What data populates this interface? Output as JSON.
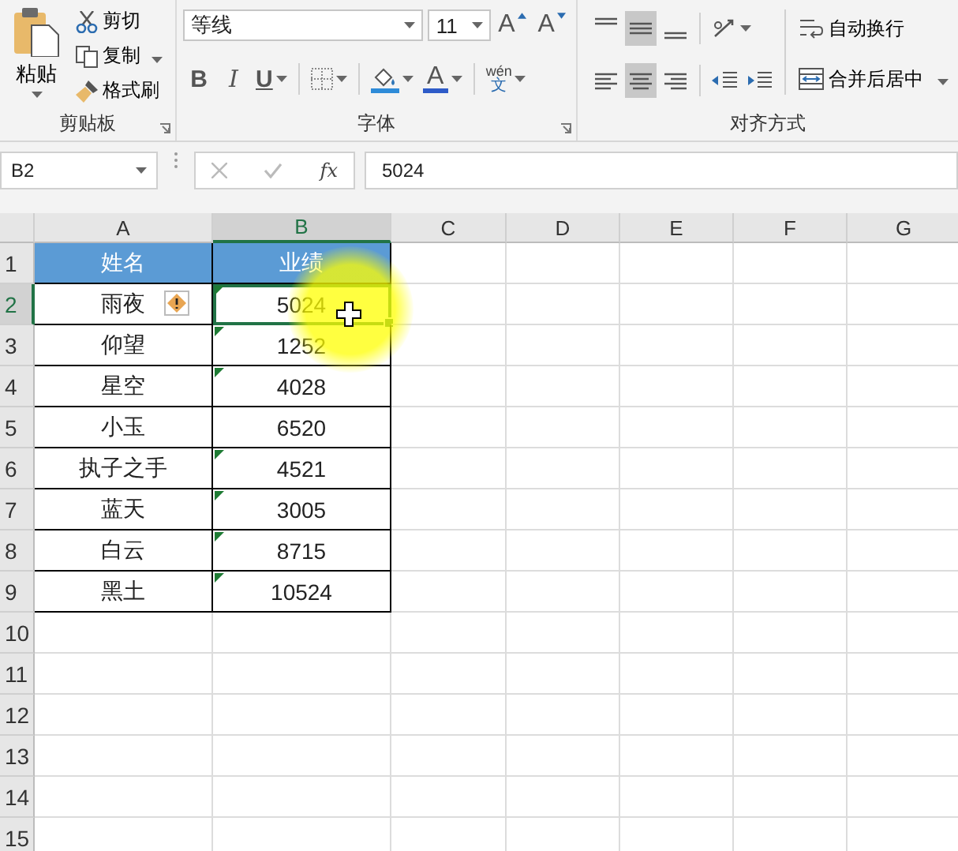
{
  "ribbon": {
    "clipboard": {
      "paste": "粘贴",
      "cut": "剪切",
      "copy": "复制",
      "format_painter": "格式刷",
      "label": "剪贴板"
    },
    "font": {
      "font_name": "等线",
      "font_size": "11",
      "label": "字体",
      "buttons": [
        {
          "kind": "grow",
          "glyph": "A"
        },
        {
          "kind": "shrink",
          "glyph": "A"
        },
        {
          "kind": "bold",
          "glyph": "B"
        },
        {
          "kind": "italic",
          "glyph": "I"
        },
        {
          "kind": "underline",
          "glyph": "U"
        },
        {
          "kind": "borders"
        },
        {
          "kind": "fill"
        },
        {
          "kind": "font_color",
          "glyph": "A"
        },
        {
          "kind": "phonetic",
          "glyph": "wén",
          "sub": "文"
        }
      ]
    },
    "alignment": {
      "label": "对齐方式",
      "wrap_text": "自动换行",
      "merge_center": "合并后居中",
      "vertical": [
        {
          "kind": "top",
          "selected": false
        },
        {
          "kind": "middle",
          "selected": true
        },
        {
          "kind": "bottom",
          "selected": false
        }
      ],
      "horizontal": [
        {
          "kind": "left",
          "selected": false
        },
        {
          "kind": "center",
          "selected": true
        },
        {
          "kind": "right",
          "selected": false
        }
      ]
    }
  },
  "formula_bar": {
    "name_box": "B2",
    "function_label": "fx",
    "formula": "5024"
  },
  "columns": [
    {
      "label": "A",
      "selected": false
    },
    {
      "label": "B",
      "selected": true
    },
    {
      "label": "C",
      "selected": false
    },
    {
      "label": "D",
      "selected": false
    },
    {
      "label": "E",
      "selected": false
    },
    {
      "label": "F",
      "selected": false
    },
    {
      "label": "G",
      "selected": false
    }
  ],
  "rows": [
    {
      "label": "1",
      "selected": false,
      "cells": [
        {
          "text": "姓名",
          "kind": "header"
        },
        {
          "text": "业绩",
          "kind": "header"
        }
      ]
    },
    {
      "label": "2",
      "selected": true,
      "cells": [
        {
          "text": "雨夜",
          "warning": true
        },
        {
          "text": "5024",
          "error_flag": true,
          "selected": true
        }
      ]
    },
    {
      "label": "3",
      "selected": false,
      "cells": [
        {
          "text": "仰望"
        },
        {
          "text": "1252",
          "error_flag": true
        }
      ]
    },
    {
      "label": "4",
      "selected": false,
      "cells": [
        {
          "text": "星空"
        },
        {
          "text": "4028",
          "error_flag": true
        }
      ]
    },
    {
      "label": "5",
      "selected": false,
      "cells": [
        {
          "text": "小玉"
        },
        {
          "text": "6520",
          "error_flag": false
        }
      ]
    },
    {
      "label": "6",
      "selected": false,
      "cells": [
        {
          "text": "执子之手"
        },
        {
          "text": "4521",
          "error_flag": true
        }
      ]
    },
    {
      "label": "7",
      "selected": false,
      "cells": [
        {
          "text": "蓝天"
        },
        {
          "text": "3005",
          "error_flag": true
        }
      ]
    },
    {
      "label": "8",
      "selected": false,
      "cells": [
        {
          "text": "白云"
        },
        {
          "text": "8715",
          "error_flag": true
        }
      ]
    },
    {
      "label": "9",
      "selected": false,
      "cells": [
        {
          "text": "黑土"
        },
        {
          "text": "10524",
          "error_flag": true
        }
      ]
    },
    {
      "label": "10",
      "selected": false,
      "cells": []
    },
    {
      "label": "11",
      "selected": false,
      "cells": []
    },
    {
      "label": "12",
      "selected": false,
      "cells": []
    },
    {
      "label": "13",
      "selected": false,
      "cells": []
    },
    {
      "label": "14",
      "selected": false,
      "cells": []
    },
    {
      "label": "15",
      "selected": false,
      "cells": []
    }
  ]
}
